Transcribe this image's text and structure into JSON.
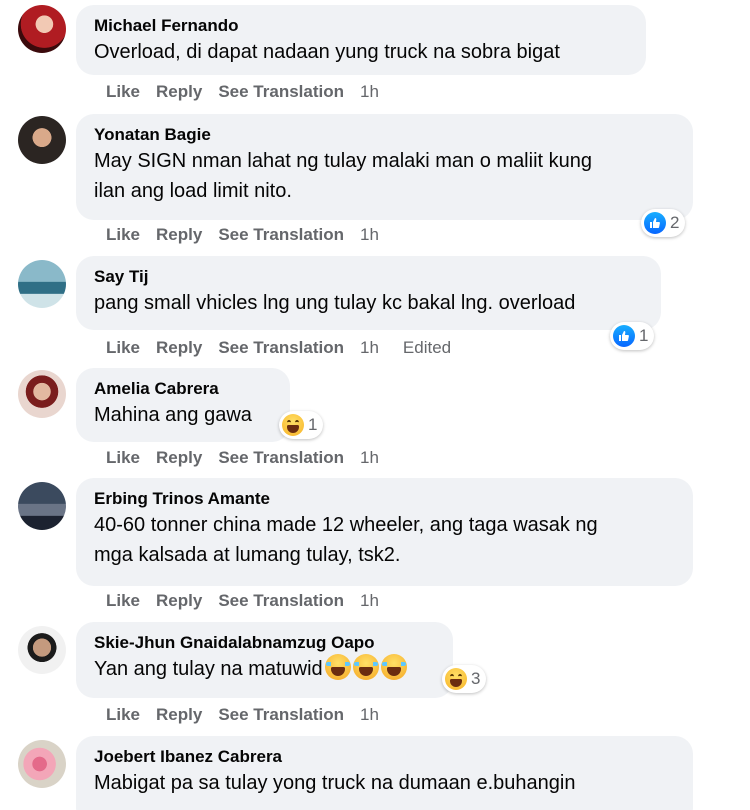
{
  "action_labels": {
    "like": "Like",
    "reply": "Reply",
    "see_translation": "See Translation"
  },
  "colors": {
    "bubble": "#f0f2f5",
    "meta": "#65676b",
    "like_blue": "#0866ff",
    "haha_yellow": "#f7b125"
  },
  "comments": [
    {
      "author": "Michael Fernando",
      "text": "Overload, di dapat nadaan yung truck na sobra bigat",
      "time": "1h"
    },
    {
      "author": "Yonatan Bagie",
      "text": "May SIGN nman lahat ng tulay malaki man o maliit kung\nilan ang load limit nito.",
      "time": "1h",
      "reaction": {
        "icon": "like-icon",
        "count": "2"
      }
    },
    {
      "author": "Say Tij",
      "text": "pang small vhicles lng ung tulay kc bakal lng. overload",
      "time": "1h",
      "edited": "Edited",
      "reaction": {
        "icon": "like-icon",
        "count": "1"
      }
    },
    {
      "author": "Amelia Cabrera",
      "text": "Mahina ang gawa",
      "time": "1h",
      "reaction": {
        "icon": "haha-icon",
        "count": "1"
      }
    },
    {
      "author": "Erbing Trinos Amante",
      "text": "40-60 tonner china made 12 wheeler, ang taga wasak ng\nmga kalsada at lumang tulay, tsk2.",
      "time": "1h"
    },
    {
      "author": "Skie-Jhun Gnaidalabnamzug Oapo",
      "text": "Yan ang tulay na matuwid",
      "emoji": "tears-of-joy-icon",
      "time": "1h",
      "reaction": {
        "icon": "haha-icon",
        "count": "3"
      }
    },
    {
      "author": "Joebert Ibanez Cabrera",
      "text": "Mabigat pa sa tulay yong truck na dumaan e.buhangin",
      "time": ""
    }
  ]
}
